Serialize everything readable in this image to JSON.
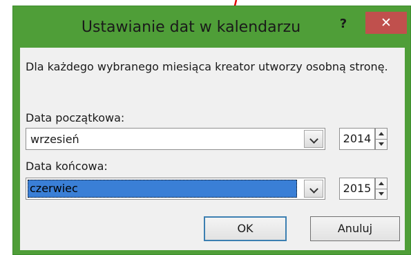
{
  "dialog": {
    "title": "Ustawianie dat w kalendarzu",
    "help_label": "?",
    "close_label": "✕",
    "accent_color": "#4f9e38",
    "close_color": "#c0504d"
  },
  "description": "Dla każdego wybranego miesiąca kreator utworzy osobną stronę.",
  "start": {
    "label": "Data początkowa:",
    "month": "wrzesień",
    "year": "2014"
  },
  "end": {
    "label": "Data końcowa:",
    "month": "czerwiec",
    "year": "2015"
  },
  "buttons": {
    "ok": "OK",
    "cancel": "Anuluj"
  },
  "annotation": {
    "arrow_color": "#e00000"
  }
}
